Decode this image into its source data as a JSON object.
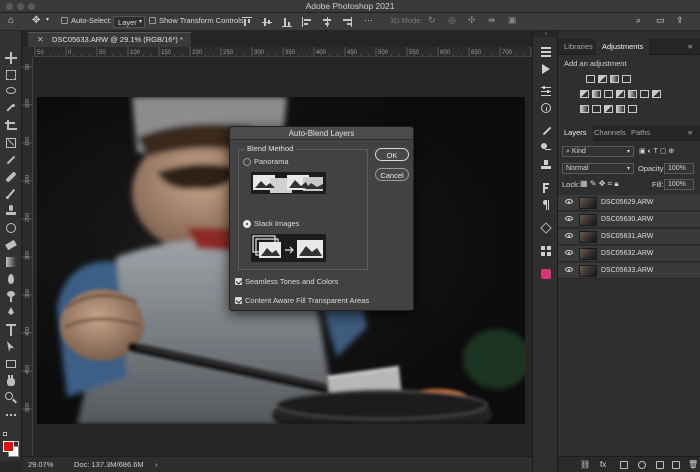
{
  "app": {
    "window_title": "Adobe Photoshop 2021"
  },
  "options_bar": {
    "auto_select_label": "Auto-Select:",
    "auto_select_target": "Layer",
    "show_transform_label": "Show Transform Controls",
    "three_d_mode_label": "3D Mode:"
  },
  "document": {
    "tab_label": "DSC05633.ARW @ 29.1% (RGB/16*) *",
    "ruler_h_ticks": [
      "50",
      "0",
      "50",
      "100",
      "150",
      "200",
      "250",
      "300",
      "350",
      "400",
      "450",
      "500",
      "550",
      "600",
      "650",
      "700",
      "750"
    ],
    "ruler_v_ticks": [
      "50",
      "100",
      "150",
      "200",
      "250",
      "300",
      "350",
      "400",
      "450",
      "500"
    ]
  },
  "status_bar": {
    "zoom": "29.07%",
    "doc_size": "Doc: 137.3M/686.6M"
  },
  "dialog": {
    "title": "Auto-Blend Layers",
    "group_label": "Blend Method",
    "option_panorama": "Panorama",
    "option_stack": "Stack Images",
    "selected_option": "Stack Images",
    "seamless_label": "Seamless Tones and Colors",
    "seamless_checked": true,
    "content_aware_label": "Content Aware Fill Transparent Areas",
    "content_aware_checked": true,
    "ok_label": "OK",
    "cancel_label": "Cancel"
  },
  "adjustments_panel": {
    "tabs": [
      "Libraries",
      "Adjustments"
    ],
    "active_tab": "Adjustments",
    "subtitle": "Add an adjustment"
  },
  "layers_panel": {
    "tabs": [
      "Layers",
      "Channels",
      "Paths"
    ],
    "active_tab": "Layers",
    "filter_label": "Kind",
    "blend_mode": "Normal",
    "opacity_label": "Opacity:",
    "opacity_value": "100%",
    "lock_label": "Lock:",
    "fill_label": "Fill:",
    "fill_value": "100%",
    "layers": [
      {
        "name": "DSC05629.ARW"
      },
      {
        "name": "DSC05630.ARW"
      },
      {
        "name": "DSC05631.ARW"
      },
      {
        "name": "DSC05632.ARW"
      },
      {
        "name": "DSC05633.ARW"
      }
    ]
  },
  "colors": {
    "foreground": "#e10e0e",
    "background": "#ffffff",
    "panel_bg": "#2f2f2f",
    "dialog_bg": "#424242"
  }
}
